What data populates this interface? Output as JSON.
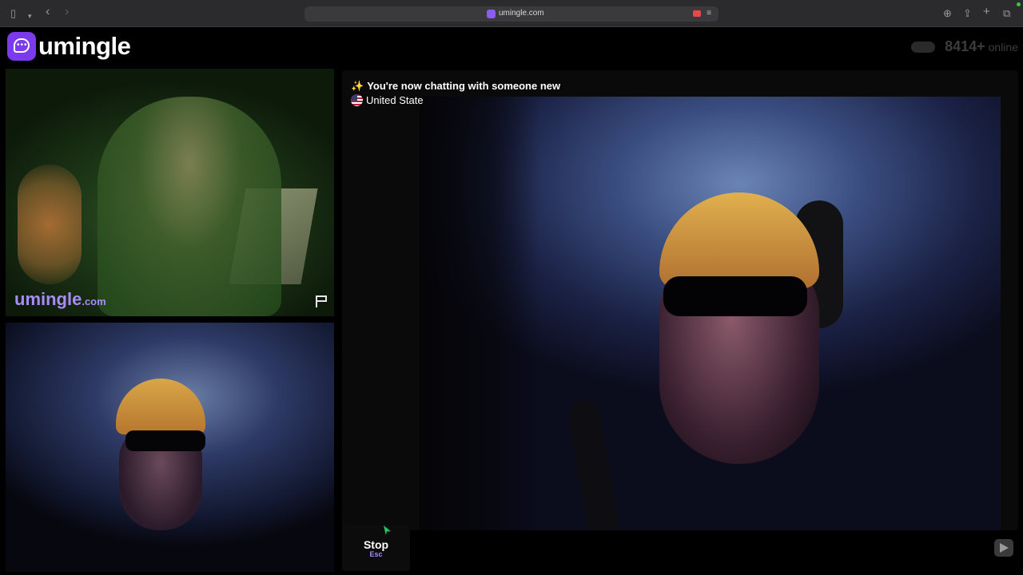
{
  "browser": {
    "url": "umingle.com",
    "icons": [
      "sidebar-icon",
      "chevron-down-icon",
      "back-icon",
      "forward-icon",
      "camera-recording-icon",
      "reader-icon",
      "download-icon",
      "share-icon",
      "new-tab-icon",
      "tabs-overview-icon"
    ]
  },
  "header": {
    "logo_text": "umingle",
    "online_count": "8414+",
    "online_label": "online"
  },
  "stranger_video": {
    "watermark_main": "umingle",
    "watermark_suffix": ".com",
    "report_icon": "flag-icon"
  },
  "chat": {
    "notice_icon": "✨",
    "notice_text": "You're now chatting with someone new",
    "country_text": "United State",
    "message_placeholder": ""
  },
  "controls": {
    "stop_label": "Stop",
    "stop_shortcut": "Esc",
    "send_icon": "send-icon"
  },
  "colors": {
    "brand": "#7c3aed",
    "brand_light": "#a78bfa",
    "background": "#000000"
  }
}
